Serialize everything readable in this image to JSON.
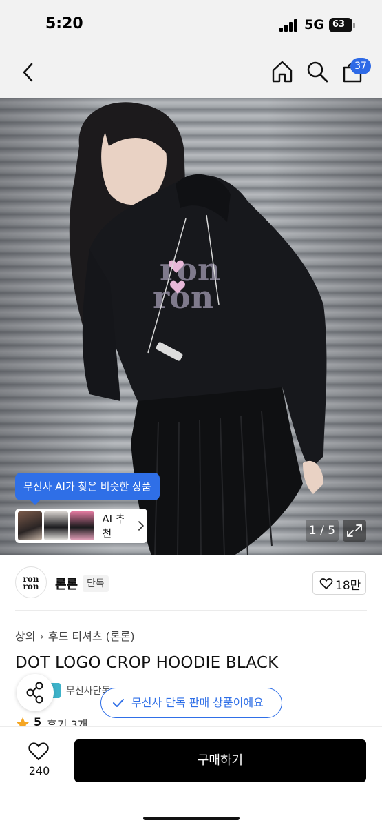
{
  "status_bar": {
    "time": "5:20",
    "network": "5G",
    "battery": "63"
  },
  "nav": {
    "cart_count": "37",
    "icons": [
      "back-icon",
      "home-icon",
      "search-icon",
      "bag-icon"
    ]
  },
  "hero": {
    "ai_tooltip": "무신사 AI가 찾은 비슷한 상품",
    "ai_recommend_label": "AI 추천",
    "counter": "1 / 5",
    "hoodie_print": "ron ron"
  },
  "brand": {
    "logo_text": "ron ron",
    "name": "론론",
    "badge": "단독",
    "like_count": "18만"
  },
  "breadcrumb": [
    "상의",
    "후드 티셔츠 (론론)"
  ],
  "product": {
    "title": "DOT LOGO CROP HOODIE BLACK",
    "tag_text": "무신사단독",
    "exclusive_notice": "무신사 단독 판매 상품이에요",
    "rating": "5",
    "reviews": "후기 3개"
  },
  "bottom_bar": {
    "wish_count": "240",
    "buy_label": "구매하기"
  },
  "colors": {
    "accent": "#2f6fe7",
    "buy_button": "#000000",
    "star": "#f5a623",
    "tag": "#3db2c9"
  }
}
